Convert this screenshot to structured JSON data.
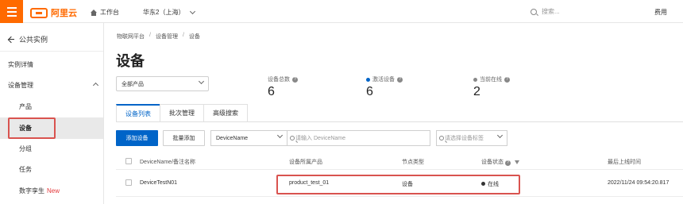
{
  "topbar": {
    "logo_text": "阿里云",
    "workbench": "工作台",
    "region": "华东2（上海）",
    "search_placeholder": "搜索...",
    "fee": "费用"
  },
  "sidebar": {
    "back_label": "公共实例",
    "items": [
      {
        "label": "实例详情"
      },
      {
        "label": "设备管理"
      }
    ],
    "subitems": [
      {
        "label": "产品"
      },
      {
        "label": "设备",
        "active": true
      },
      {
        "label": "分组"
      },
      {
        "label": "任务"
      },
      {
        "label": "数字孪生",
        "badge": "New"
      }
    ]
  },
  "main": {
    "breadcrumb": [
      "物联网平台",
      "设备管理",
      "设备"
    ],
    "title": "设备",
    "product_select": "全部产品",
    "stats": [
      {
        "label": "设备总数",
        "value": "6"
      },
      {
        "label": "激活设备",
        "value": "6",
        "dot_color": "#0064c8"
      },
      {
        "label": "当前在线",
        "value": "2",
        "dot_color": "#888888"
      }
    ],
    "tabs": [
      {
        "label": "设备列表",
        "active": true
      },
      {
        "label": "批次管理"
      },
      {
        "label": "高级搜索"
      }
    ],
    "toolbar": {
      "add_device": "添加设备",
      "batch_add": "批量添加",
      "field_select": "DeviceName",
      "search_placeholder": "请输入 DeviceName",
      "tag_placeholder": "请选择设备标签"
    },
    "table": {
      "columns": [
        "DeviceName/备注名称",
        "设备所属产品",
        "节点类型",
        "设备状态",
        "最后上线时间"
      ],
      "rows": [
        {
          "device_name": "DeviceTestN01",
          "product": "product_test_01",
          "node_type": "设备",
          "status": "在线",
          "last_online": "2022/11/24 09:54:20.817"
        }
      ]
    }
  },
  "colors": {
    "brand": "#ff6a00",
    "primary": "#0064c8",
    "highlight": "#d9534f"
  }
}
